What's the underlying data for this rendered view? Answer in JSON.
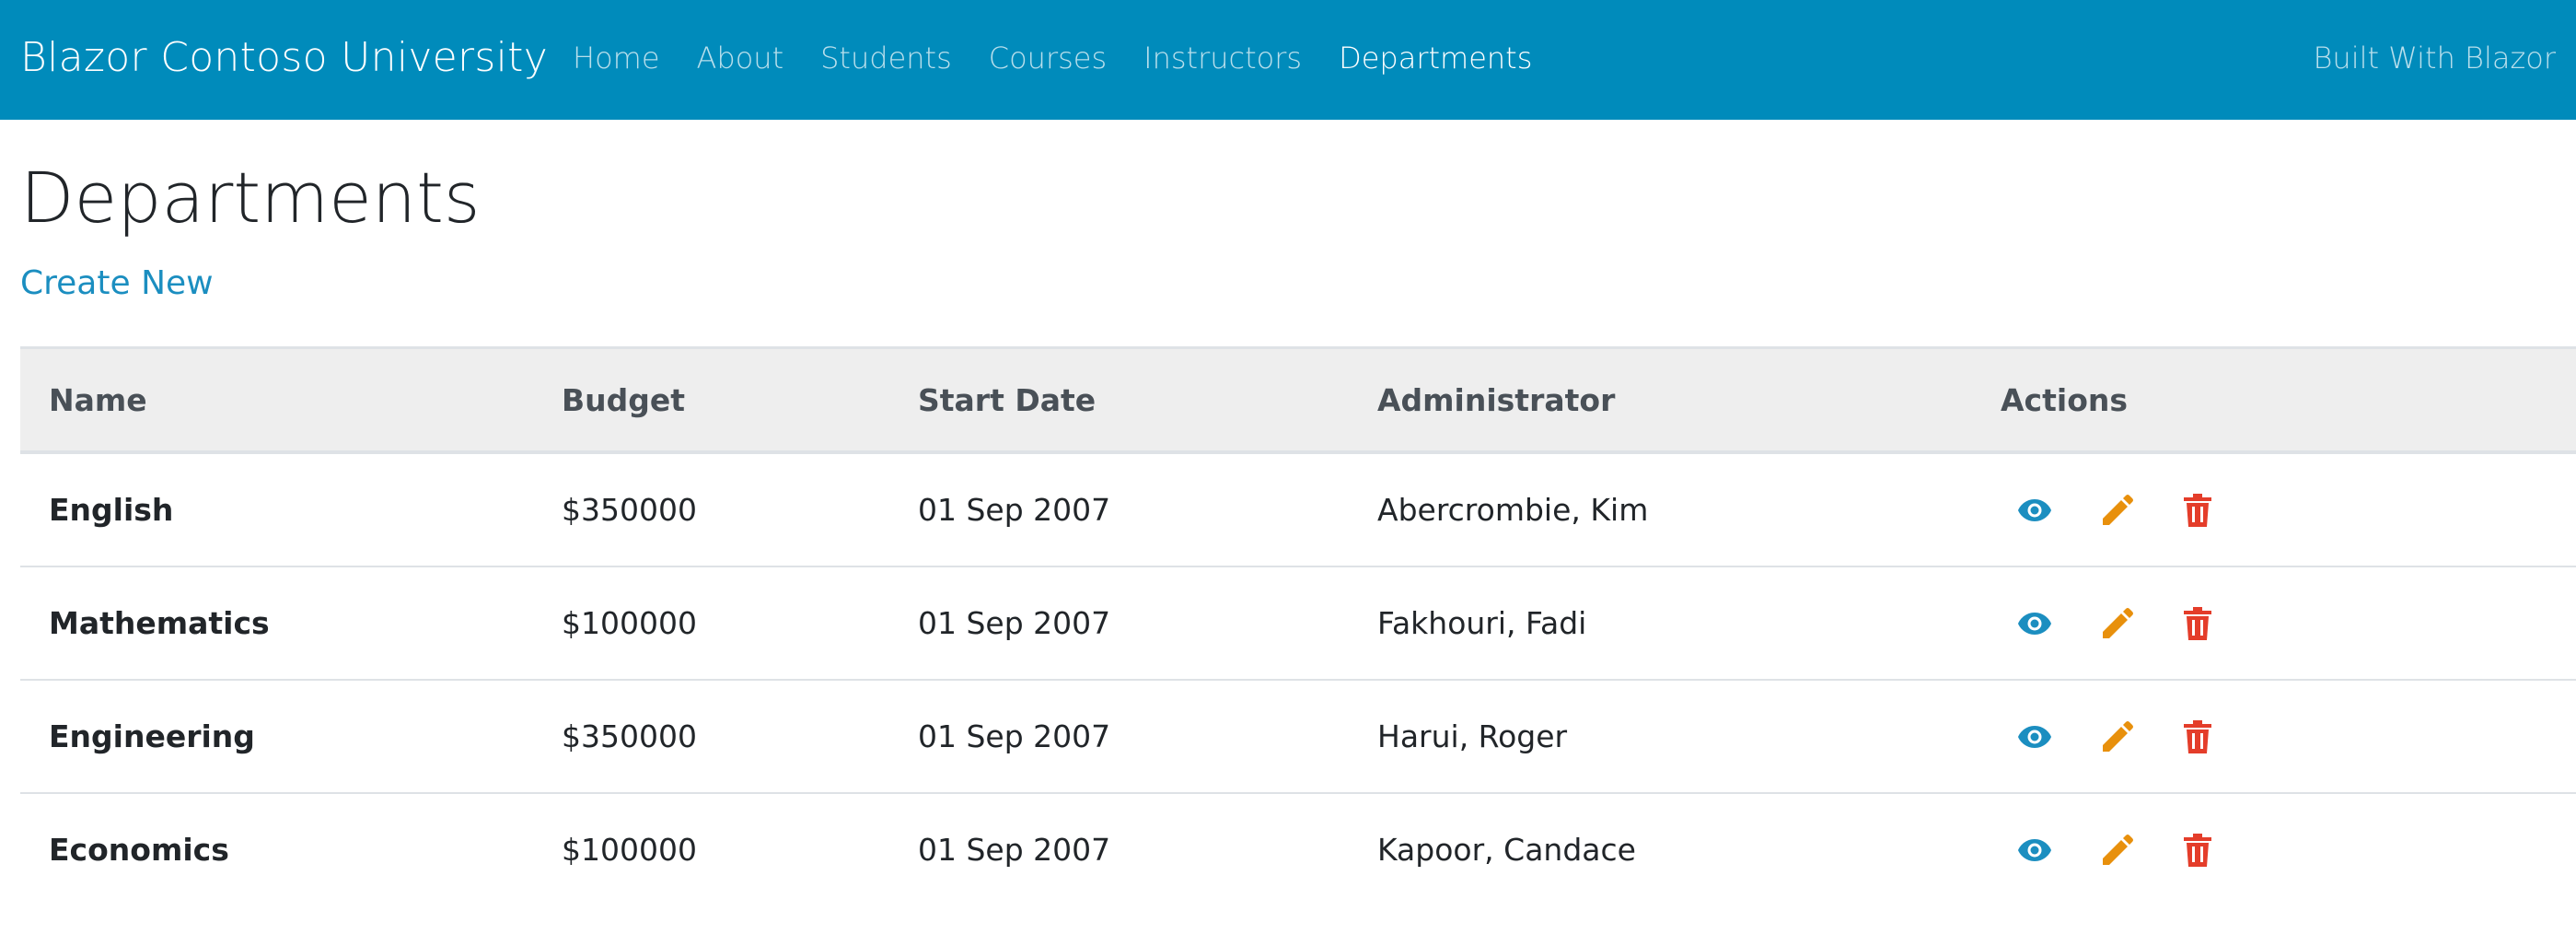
{
  "navbar": {
    "brand": "Blazor Contoso University",
    "links": [
      {
        "label": "Home",
        "active": false
      },
      {
        "label": "About",
        "active": false
      },
      {
        "label": "Students",
        "active": false
      },
      {
        "label": "Courses",
        "active": false
      },
      {
        "label": "Instructors",
        "active": false
      },
      {
        "label": "Departments",
        "active": true
      }
    ],
    "right_link": "Built With Blazor",
    "background_color": "#008bbb"
  },
  "page": {
    "title": "Departments",
    "create_link": "Create New"
  },
  "table": {
    "headers": [
      "Name",
      "Budget",
      "Start Date",
      "Administrator",
      "Actions"
    ],
    "rows": [
      {
        "name": "English",
        "budget": "$350000",
        "start_date": "01 Sep 2007",
        "administrator": "Abercrombie, Kim"
      },
      {
        "name": "Mathematics",
        "budget": "$100000",
        "start_date": "01 Sep 2007",
        "administrator": "Fakhouri, Fadi"
      },
      {
        "name": "Engineering",
        "budget": "$350000",
        "start_date": "01 Sep 2007",
        "administrator": "Harui, Roger"
      },
      {
        "name": "Economics",
        "budget": "$100000",
        "start_date": "01 Sep 2007",
        "administrator": "Kapoor, Candace"
      }
    ],
    "actions": [
      {
        "icon": "eye-icon",
        "color": "#1b8ec0"
      },
      {
        "icon": "pencil-icon",
        "color": "#e8900c"
      },
      {
        "icon": "trash-icon",
        "color": "#e43d2a"
      }
    ]
  }
}
